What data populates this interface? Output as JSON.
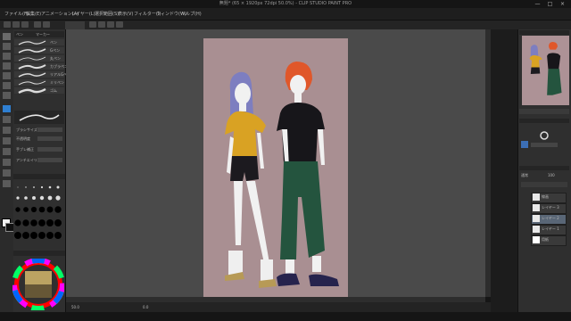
{
  "window": {
    "title": "無題* (65 × 1920px 72dpi 50.0%) - CLIP STUDIO PAINT PRO",
    "minimize": "—",
    "maximize": "□",
    "close": "×"
  },
  "menu": [
    "ファイル(F)",
    "編集(E)",
    "アニメーション(A)",
    "レイヤー(L)",
    "選択範囲(S)",
    "表示(V)",
    "フィルター(I)",
    "ウィンドウ(W)",
    "ヘルプ(H)"
  ],
  "subtool": {
    "tab1": "ペン",
    "tab2": "マーカー",
    "brushes": [
      "ペン",
      "Gペン",
      "丸ペン",
      "カブラペン",
      "リアルGペン",
      "ミリペン",
      "ゴム"
    ],
    "props": [
      "ブラシサイズ",
      "不透明度",
      "手ブレ補正",
      "アンチエイリアス"
    ]
  },
  "layers": {
    "blend": "通常",
    "opacity": "100",
    "items": [
      "線画",
      "レイヤー 3",
      "レイヤー 2",
      "レイヤー 1",
      "用紙"
    ]
  },
  "status": {
    "zoom": "50.0",
    "angle": "0.0"
  }
}
